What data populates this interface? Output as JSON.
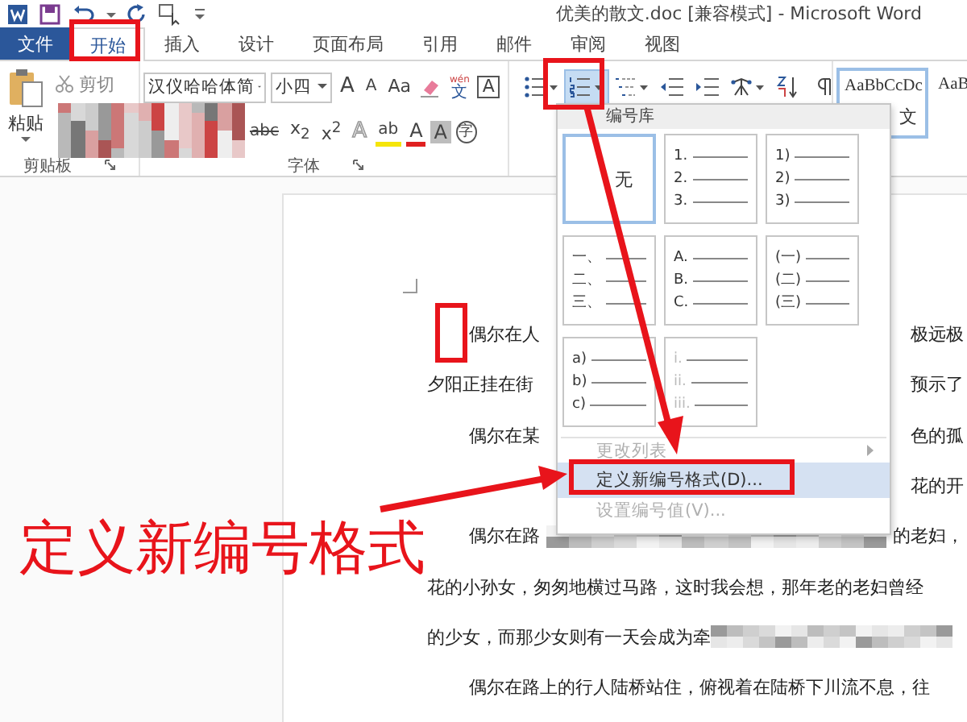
{
  "title_bar": {
    "title": "优美的散文.doc [兼容模式] - Microsoft Word"
  },
  "tabs": [
    {
      "label": "文件",
      "kind": "file",
      "selected": false
    },
    {
      "label": "开始",
      "kind": "tab",
      "selected": true
    },
    {
      "label": "插入",
      "kind": "tab",
      "selected": false
    },
    {
      "label": "设计",
      "kind": "tab",
      "selected": false
    },
    {
      "label": "页面布局",
      "kind": "tab",
      "selected": false
    },
    {
      "label": "引用",
      "kind": "tab",
      "selected": false
    },
    {
      "label": "邮件",
      "kind": "tab",
      "selected": false
    },
    {
      "label": "审阅",
      "kind": "tab",
      "selected": false
    },
    {
      "label": "视图",
      "kind": "tab",
      "selected": false
    }
  ],
  "clipboard": {
    "paste": "粘贴",
    "cut": "剪切",
    "group_label": "剪贴板"
  },
  "font": {
    "name": "汉仪哈哈体简",
    "size": "小四",
    "group_label": "字体",
    "row1": [
      {
        "kind": "grow",
        "text": "A"
      },
      {
        "kind": "shrink",
        "text": "A"
      },
      {
        "kind": "case",
        "text": "Aa"
      },
      {
        "kind": "clear"
      },
      {
        "kind": "phonetic",
        "ruby": "wén",
        "text": "文"
      },
      {
        "kind": "border",
        "text": "A"
      }
    ],
    "row2": [
      {
        "kind": "strike",
        "text": "abc"
      },
      {
        "kind": "script",
        "text": "x$_{2}$"
      },
      {
        "kind": "script",
        "text": "x$^{2}$"
      },
      {
        "kind": "outline",
        "text": "A"
      },
      {
        "kind": "highlight",
        "text": "ab"
      },
      {
        "kind": "color",
        "text": "A"
      },
      {
        "kind": "shaded",
        "text": "A"
      },
      {
        "kind": "enclose",
        "text": "字"
      }
    ]
  },
  "paragraph_tools": [
    {
      "kind": "bullets",
      "selected": false
    },
    {
      "kind": "numbering",
      "selected": true
    },
    {
      "kind": "multilevel",
      "selected": false
    },
    {
      "kind": "outdent",
      "selected": false
    },
    {
      "kind": "indent",
      "selected": false
    },
    {
      "kind": "asian_layout",
      "selected": false
    },
    {
      "kind": "sort",
      "selected": false
    },
    {
      "kind": "marks",
      "selected": false
    }
  ],
  "styles": [
    {
      "sample": "AaBbCcDc",
      "label": "文",
      "selected": true
    },
    {
      "sample": "AaB",
      "selected": false
    }
  ],
  "numbering_menu": {
    "header": "编号库",
    "cells": [
      {
        "kind": "none",
        "label": "无",
        "selected": true
      },
      {
        "kind": "list",
        "markers": [
          "1.",
          "2.",
          "3."
        ],
        "faded": false,
        "selected": false
      },
      {
        "kind": "list",
        "markers": [
          "1)",
          "2)",
          "3)"
        ],
        "faded": false,
        "selected": false
      },
      {
        "kind": "list",
        "markers": [
          "一、",
          "二、",
          "三、"
        ],
        "faded": false,
        "selected": false
      },
      {
        "kind": "list",
        "markers": [
          "A.",
          "B.",
          "C."
        ],
        "faded": false,
        "selected": false
      },
      {
        "kind": "list",
        "markers": [
          "(一)",
          "(二)",
          "(三)"
        ],
        "faded": false,
        "selected": false
      },
      {
        "kind": "list",
        "markers": [
          "a)",
          "b)",
          "c)"
        ],
        "faded": false,
        "selected": false
      },
      {
        "kind": "list",
        "markers": [
          "i.",
          "ii.",
          "iii."
        ],
        "faded": true,
        "selected": false
      }
    ],
    "items": [
      {
        "label": "更改列表",
        "disabled": true,
        "submenu": true,
        "selected": false
      },
      {
        "label": "定义新编号格式(D)...",
        "disabled": false,
        "submenu": false,
        "selected": true
      },
      {
        "label": "设置编号值(V)...",
        "disabled": true,
        "submenu": false,
        "selected": false
      }
    ]
  },
  "document": {
    "lines": [
      {
        "kind": "split",
        "indent": true,
        "left": "偶尔在人",
        "right": "极远极"
      },
      {
        "kind": "split",
        "indent": false,
        "left": "夕阳正挂在街",
        "right": "预示了"
      },
      {
        "kind": "split",
        "indent": true,
        "left": "偶尔在某",
        "right": "色的孤"
      },
      {
        "kind": "right_only",
        "indent": false,
        "right": "花的开"
      },
      {
        "kind": "blurred_middle",
        "indent": true,
        "left": "偶尔在路",
        "right": "的老妇，"
      },
      {
        "kind": "full",
        "indent": false,
        "left": "花的小孙女，匆匆地横过马路，这时我会想，那年老的老妇曾经"
      },
      {
        "kind": "blurred_end",
        "indent": false,
        "left": "的少女，而那少女则有一天会成为牵"
      },
      {
        "kind": "full",
        "indent": true,
        "left": "偶尔在路上的行人陆桥站住，俯视着在陆桥下川流不息，往"
      }
    ]
  },
  "annotation": {
    "caption": "定义新编号格式"
  }
}
